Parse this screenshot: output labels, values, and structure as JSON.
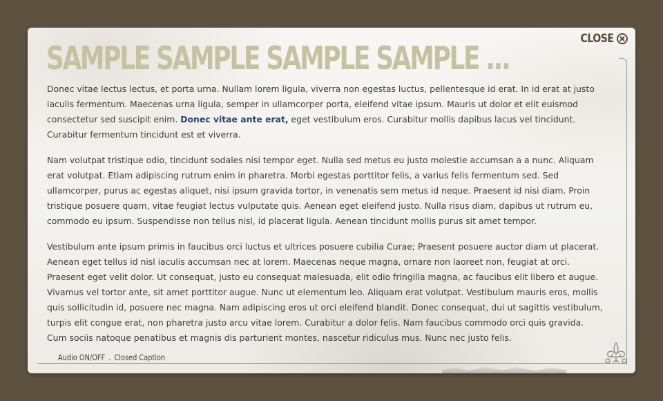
{
  "dialog": {
    "title": "SAMPLE SAMPLE SAMPLE SAMPLE ...",
    "close_label": "CLOSE",
    "close_icon": "close-circle-icon",
    "ornament_icon": "fleur-de-lis-ornament-icon"
  },
  "content": {
    "paragraph1_before": "Donec vitae lectus lectus, et porta urna. Nullam lorem ligula, viverra non egestas luctus, pellentesque id erat. In id erat at justo iaculis fermentum. Maecenas urna ligula, semper in ullamcorper porta, eleifend vitae ipsum. Mauris ut dolor et elit euismod consectetur sed suscipit enim. ",
    "paragraph1_highlight": "Donec vitae ante erat,",
    "paragraph1_after": " eget vestibulum eros. Curabitur mollis dapibus lacus vel tincidunt. Curabitur fermentum tincidunt est et viverra.",
    "paragraph2": "Nam volutpat tristique odio, tincidunt sodales nisi tempor eget. Nulla sed metus eu justo molestie accumsan a a nunc. Aliquam erat volutpat. Etiam adipiscing rutrum enim in pharetra. Morbi egestas porttitor felis, a varius felis fermentum sed. Sed ullamcorper, purus ac egestas aliquet, nisi ipsum gravida tortor, in venenatis sem metus id neque. Praesent id nisi diam. Proin tristique posuere quam, vitae feugiat lectus vulputate quis. Aenean eget eleifend justo. Nulla risus diam, dapibus ut rutrum eu, commodo eu ipsum. Suspendisse non tellus nisl, id placerat ligula. Aenean tincidunt mollis purus sit amet tempor.",
    "paragraph3": "Vestibulum ante ipsum primis in faucibus orci luctus et ultrices posuere cubilia Curae; Praesent posuere auctor diam ut placerat. Aenean eget tellus id nisl iaculis accumsan nec at lorem. Maecenas neque magna, ornare non laoreet non, feugiat at orci. Praesent eget velit dolor. Ut consequat, justo eu consequat malesuada, elit odio fringilla magna, ac faucibus elit libero et augue. Vivamus vel tortor ante, sit amet porttitor augue. Nunc ut elementum leo. Aliquam erat volutpat. Vestibulum mauris eros, mollis quis sollicitudin id, posuere nec magna. Nam adipiscing eros ut orci eleifend blandit. Donec consequat, dui ut sagittis vestibulum, turpis elit congue erat, non pharetra justo arcu vitae lorem. Curabitur a dolor felis. Nam faucibus commodo orci quis gravida. Cum sociis natoque penatibus et magnis dis parturient montes, nascetur ridiculus mus. Nunc nec justo felis."
  },
  "footer": {
    "audio_label": "Audio ON/OFF",
    "separator": ".",
    "caption_label": "Closed Caption"
  },
  "colors": {
    "background": "#5e5140",
    "title": "#c6c1a0",
    "highlight": "#2c4370",
    "close": "#5a4c3c"
  }
}
